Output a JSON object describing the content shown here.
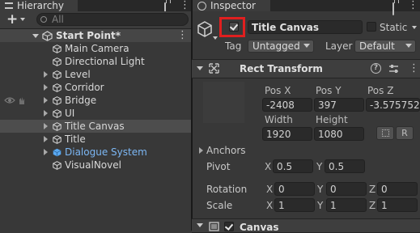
{
  "hierarchy": {
    "tab_label": "Hierarchy",
    "add_label": "+",
    "search_placeholder": "All",
    "scene": "Start Point*",
    "items": [
      {
        "label": "Main Camera"
      },
      {
        "label": "Directional Light"
      },
      {
        "label": "Level"
      },
      {
        "label": "Corridor"
      },
      {
        "label": "Bridge"
      },
      {
        "label": "UI"
      },
      {
        "label": "Title Canvas"
      },
      {
        "label": "Title"
      },
      {
        "label": "Dialogue System"
      },
      {
        "label": "VisualNovel"
      }
    ]
  },
  "inspector": {
    "tab_label": "Inspector",
    "object_name": "Title Canvas",
    "static_label": "Static",
    "tag_label": "Tag",
    "tag_value": "Untagged",
    "layer_label": "Layer",
    "layer_value": "Default",
    "rect_transform": {
      "title": "Rect Transform",
      "pos_x_label": "Pos X",
      "pos_y_label": "Pos Y",
      "pos_z_label": "Pos Z",
      "pos_x": "-2408",
      "pos_y": "397",
      "pos_z": "-3.575752",
      "width_label": "Width",
      "height_label": "Height",
      "width": "1920",
      "height": "1080",
      "r_button": "R",
      "anchors_label": "Anchors",
      "pivot_label": "Pivot",
      "pivot_x_label": "X",
      "pivot_x": "0.5",
      "pivot_y_label": "Y",
      "pivot_y": "0.5",
      "rotation_label": "Rotation",
      "rot_x_label": "X",
      "rot_x": "0",
      "rot_y_label": "Y",
      "rot_y": "0",
      "rot_z_label": "Z",
      "rot_z": "0",
      "scale_label": "Scale",
      "scale_x_label": "X",
      "scale_x": "1",
      "scale_y_label": "Y",
      "scale_y": "1",
      "scale_z_label": "Z",
      "scale_z": "1"
    },
    "canvas_title": "Canvas"
  },
  "colors": {
    "selection_bg": "#4d4d4d",
    "highlight_box": "#e01f1f",
    "prefab_blue": "#7cb7f4"
  }
}
